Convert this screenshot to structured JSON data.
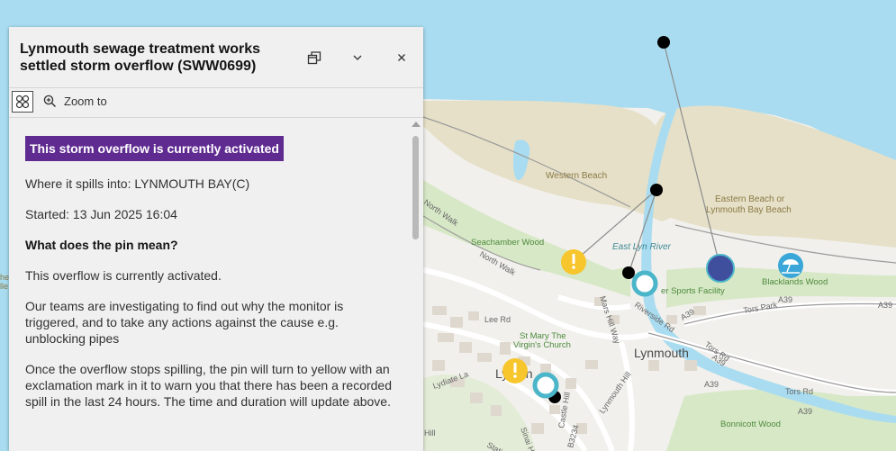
{
  "popup": {
    "title": "Lynmouth sewage treatment works settled storm overflow (SWW0699)",
    "zoom_label": "Zoom to",
    "status_badge": "This storm overflow is currently activated",
    "spills_into": "Where it spills into: LYNMOUTH BAY(C)",
    "started": "Started: 13 Jun 2025 16:04",
    "pin_heading": "What does the pin mean?",
    "pin_para1": "This overflow is currently activated.",
    "pin_para2": "Our teams are investigating to find out why the monitor is triggered, and to take any actions against the cause e.g. unblocking pipes",
    "pin_para3": "Once the overflow stops spilling, the pin will turn to yellow with an exclamation mark in it to warn you that there has been a recorded spill in the last 24 hours. The time and duration will update above."
  },
  "map": {
    "labels": {
      "western_beach": "Western Beach",
      "eastern_beach": "Eastern Beach or",
      "eastern_beach2": "Lynmouth Bay Beach",
      "east_lyn_river": "East Lyn River",
      "seachamber_wood": "Seachamber Wood",
      "north_walk": "North Walk",
      "north_walk2": "North Walk",
      "lee_rd": "Lee Rd",
      "mars_hill": "Mars Hill Way",
      "riverside_rd": "Riverside Rd",
      "st_mary1": "St Mary The",
      "st_mary2": "Virgin's Church",
      "lynmouth": "Lynmouth",
      "lynton": "Lynton",
      "water_sports": "er Sports Facility",
      "blacklands": "Blacklands Wood",
      "tors_park": "Tors Park",
      "tors_rd": "Tors Rd",
      "tors_rd2": "Tors Rd",
      "a39_1": "A39",
      "a39_2": "A39",
      "a39_3": "A39",
      "a39_4": "A39",
      "a39_5": "A39",
      "a39_6": "A39",
      "bonnicott": "Bonnicott Wood",
      "lynmouth_hill": "Lynmouth Hill",
      "castle_hill": "Castle Hill",
      "sinai_hill": "Sinai Hill",
      "lydiate_la": "Lydiate La",
      "b3234": "B3234",
      "hill": "Hill",
      "station": "Station",
      "he": "he",
      "lle": "lle"
    },
    "colors": {
      "sea": "#a9dcf0",
      "beach": "#e6e0c8",
      "land": "#f1f0ec",
      "wood": "#d7e8c6",
      "activated_pin": "#3f4f9e",
      "warning_pin": "#f7c52c",
      "ring_pin": "#4bb5c9",
      "popup_badge": "#5f2b91"
    },
    "icons": [
      "beach-umbrella-icon",
      "warning-icon"
    ]
  }
}
